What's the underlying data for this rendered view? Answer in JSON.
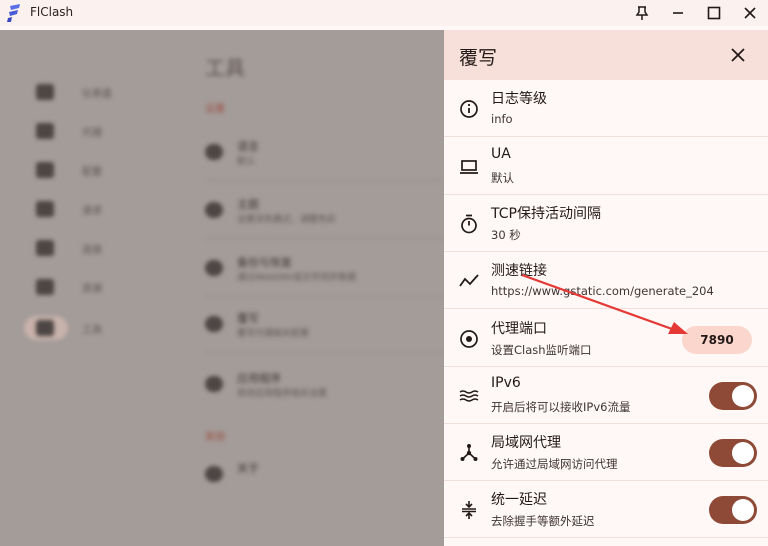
{
  "window": {
    "title": "FlClash"
  },
  "background": {
    "page_title": "工具",
    "section_labels": [
      "设置",
      "其他"
    ],
    "nav_items": [
      "仪表盘",
      "代理",
      "配置",
      "请求",
      "连接",
      "资源",
      "工具"
    ],
    "rows": [
      {
        "title": "语言",
        "subtitle": "默认"
      },
      {
        "title": "主题",
        "subtitle": "设置深色模式，调整色彩"
      },
      {
        "title": "备份与恢复",
        "subtitle": "通过WebDAV或文件同步数据"
      },
      {
        "title": "覆写",
        "subtitle": "覆写代理相关配置"
      },
      {
        "title": "应用程序",
        "subtitle": "修改应用程序相关设置"
      },
      {
        "title": "关于",
        "subtitle": ""
      }
    ]
  },
  "panel": {
    "title": "覆写",
    "items": [
      {
        "title": "日志等级",
        "subtitle": "info",
        "icon": "info-icon"
      },
      {
        "title": "UA",
        "subtitle": "默认",
        "icon": "laptop-icon"
      },
      {
        "title": "TCP保持活动间隔",
        "subtitle": "30 秒",
        "icon": "timer-icon"
      },
      {
        "title": "测速链接",
        "subtitle": "https://www.gstatic.com/generate_204",
        "icon": "trending-icon"
      },
      {
        "title": "代理端口",
        "subtitle": "设置Clash监听端口",
        "icon": "target-icon",
        "value": "7890"
      },
      {
        "title": "IPv6",
        "subtitle": "开启后将可以接收IPv6流量",
        "icon": "waves-icon",
        "enabled": true
      },
      {
        "title": "局域网代理",
        "subtitle": "允许通过局域网访问代理",
        "icon": "hub-icon",
        "enabled": true
      },
      {
        "title": "统一延迟",
        "subtitle": "去除握手等额外延迟",
        "icon": "compress-icon",
        "enabled": true
      }
    ]
  },
  "colors": {
    "accent": "#8e4a37",
    "header_bg": "#f7e0da",
    "panel_bg": "#fff8f6",
    "annotation_arrow": "#e53935"
  }
}
